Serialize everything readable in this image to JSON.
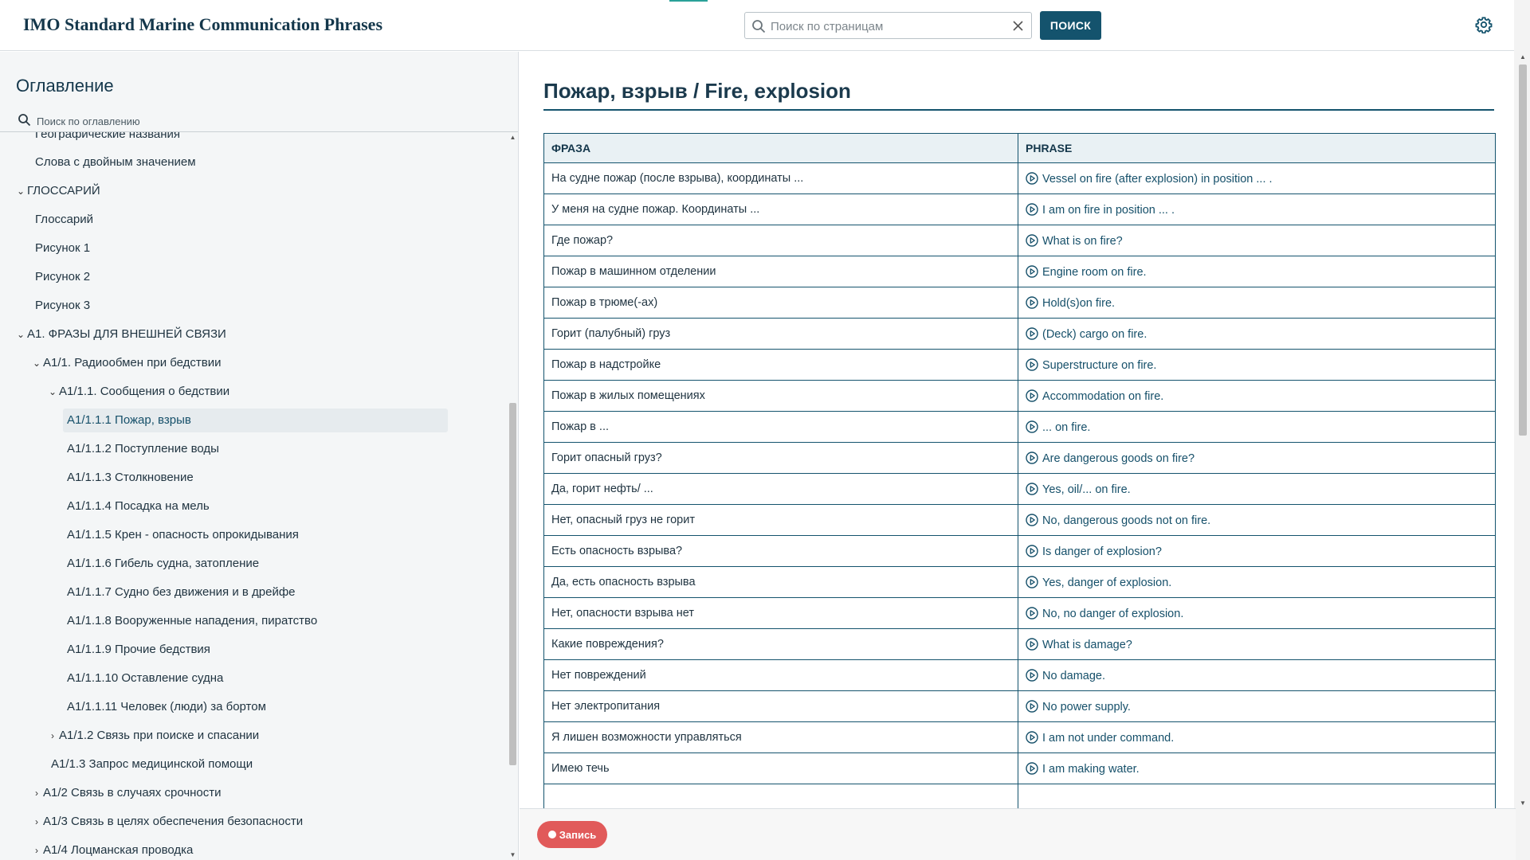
{
  "header": {
    "app_title": "IMO Standard Marine Communication Phrases",
    "search_placeholder": "Поиск по страницам",
    "search_button": "ПОИСК",
    "accent_color": "#14536d"
  },
  "sidebar": {
    "title": "Оглавление",
    "search_placeholder": "Поиск по оглавлению",
    "items": [
      {
        "label": "Географические названия",
        "chevron": ""
      },
      {
        "label": "Слова с двойным значением",
        "chevron": ""
      },
      {
        "label": "ГЛОССАРИЙ",
        "chevron": "down"
      },
      {
        "label": "Глоссарий",
        "chevron": ""
      },
      {
        "label": "Рисунок 1",
        "chevron": ""
      },
      {
        "label": "Рисунок 2",
        "chevron": ""
      },
      {
        "label": "Рисунок 3",
        "chevron": ""
      },
      {
        "label": "A1. ФРАЗЫ ДЛЯ ВНЕШНЕЙ СВЯЗИ",
        "chevron": "down"
      },
      {
        "label": "A1/1. Радиообмен при бедствии",
        "chevron": "down"
      },
      {
        "label": "A1/1.1. Сообщения о бедствии",
        "chevron": "down"
      },
      {
        "label": "A1/1.1.1 Пожар, взрыв",
        "chevron": "",
        "active": true
      },
      {
        "label": "A1/1.1.2 Поступление воды",
        "chevron": ""
      },
      {
        "label": "A1/1.1.3 Столкновение",
        "chevron": ""
      },
      {
        "label": "A1/1.1.4 Посадка на мель",
        "chevron": ""
      },
      {
        "label": "A1/1.1.5 Крен - опасность опрокидывания",
        "chevron": ""
      },
      {
        "label": "A1/1.1.6 Гибель судна, затопление",
        "chevron": ""
      },
      {
        "label": "A1/1.1.7 Судно без движения и в дрейфе",
        "chevron": ""
      },
      {
        "label": "A1/1.1.8 Вооруженные нападения, пиратство",
        "chevron": ""
      },
      {
        "label": "A1/1.1.9 Прочие бедствия",
        "chevron": ""
      },
      {
        "label": "A1/1.1.10 Оставление судна",
        "chevron": ""
      },
      {
        "label": "A1/1.1.11 Человек (люди) за бортом",
        "chevron": ""
      },
      {
        "label": "A1/1.2 Связь при поиске и спасании",
        "chevron": "right"
      },
      {
        "label": "A1/1.3 Запрос медицинской помощи",
        "chevron": ""
      },
      {
        "label": "A1/2 Связь в случаях срочности",
        "chevron": "right"
      },
      {
        "label": "A1/3 Связь в целях обеспечения безопасности",
        "chevron": "right"
      },
      {
        "label": "A1/4 Лоцманская проводка",
        "chevron": "right"
      }
    ]
  },
  "main": {
    "page_title": "Пожар, взрыв / Fire, explosion",
    "columns": [
      "ФРАЗА",
      "PHRASE"
    ],
    "rows": [
      {
        "ru": "На судне пожар (после взрыва), координаты ...",
        "en": "Vessel on fire (after explosion) in position ... ."
      },
      {
        "ru": "У меня на судне пожар. Координаты ...",
        "en": "I am on fire in position ... ."
      },
      {
        "ru": "Где пожар?",
        "en": "What is on fire?"
      },
      {
        "ru": "Пожар в машинном отделении",
        "en": "Engine room on fire."
      },
      {
        "ru": "Пожар в трюме(-ах)",
        "en": "Hold(s)on fire."
      },
      {
        "ru": "Горит (палубный) груз",
        "en": "(Deck) cargo on fire."
      },
      {
        "ru": "Пожар в надстройке",
        "en": "Superstructure on fire."
      },
      {
        "ru": "Пожар в жилых помещениях",
        "en": "Accommodation on fire."
      },
      {
        "ru": "Пожар в ...",
        "en": "... on fire."
      },
      {
        "ru": "Горит опасный груз?",
        "en": "Are dangerous goods on fire?"
      },
      {
        "ru": "Да, горит нефть/ ...",
        "en": "Yes, oil/... on fire."
      },
      {
        "ru": "Нет, опасный груз не горит",
        "en": "No, dangerous goods not on fire."
      },
      {
        "ru": "Есть опасность взрыва?",
        "en": "Is danger of explosion?"
      },
      {
        "ru": "Да, есть опасность взрыва",
        "en": "Yes, danger of explosion."
      },
      {
        "ru": "Нет, опасности взрыва нет",
        "en": "No, no danger of explosion."
      },
      {
        "ru": "Какие повреждения?",
        "en": "What is damage?"
      },
      {
        "ru": "Нет повреждений",
        "en": "No damage."
      },
      {
        "ru": "Нет электропитания",
        "en": "No power supply."
      },
      {
        "ru": "Я лишен возможности управляться",
        "en": "I am not under command."
      },
      {
        "ru": "Имею течь",
        "en": "I am making water."
      },
      {
        "ru": "",
        "en": ""
      }
    ]
  },
  "footer": {
    "record_label": "Запись",
    "record_color": "#e15a5a"
  }
}
